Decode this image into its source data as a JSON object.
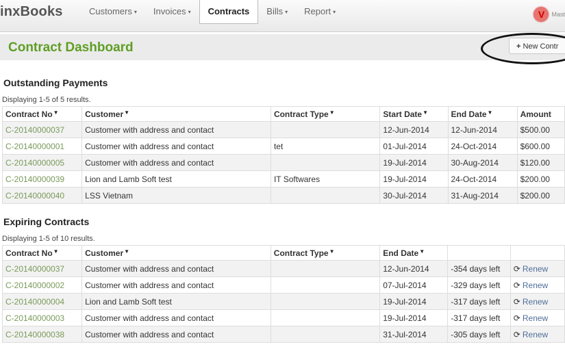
{
  "nav": {
    "brand": "inxBooks",
    "items": [
      {
        "label": "Customers",
        "caret": "▾"
      },
      {
        "label": "Invoices",
        "caret": "▾"
      },
      {
        "label": "Contracts",
        "caret": ""
      },
      {
        "label": "Bills",
        "caret": "▾"
      },
      {
        "label": "Report",
        "caret": "▾"
      }
    ],
    "user_initial": "V",
    "user_name": "Mast"
  },
  "header": {
    "title": "Contract Dashboard",
    "new_button": "New Contr",
    "new_button_icon": "+"
  },
  "outstanding": {
    "title": "Outstanding Payments",
    "summary": "Displaying 1-5 of 5 results.",
    "columns": [
      "Contract No",
      "Customer",
      "Contract Type",
      "Start Date",
      "End Date",
      "Amount"
    ],
    "rows": [
      [
        "C-20140000037",
        "Customer with address and contact",
        "",
        "12-Jun-2014",
        "12-Jun-2014",
        "$500.00"
      ],
      [
        "C-20140000001",
        "Customer with address and contact",
        "tet",
        "01-Jul-2014",
        "24-Oct-2014",
        "$600.00"
      ],
      [
        "C-20140000005",
        "Customer with address and contact",
        "",
        "19-Jul-2014",
        "30-Aug-2014",
        "$120.00"
      ],
      [
        "C-20140000039",
        "Lion and Lamb Soft test",
        "IT Softwares",
        "19-Jul-2014",
        "24-Oct-2014",
        "$200.00"
      ],
      [
        "C-20140000040",
        "LSS Vietnam",
        "",
        "30-Jul-2014",
        "31-Aug-2014",
        "$200.00"
      ]
    ]
  },
  "expiring": {
    "title": "Expiring Contracts",
    "summary": "Displaying 1-5 of 10 results.",
    "columns": [
      "Contract No",
      "Customer",
      "Contract Type",
      "End Date",
      "",
      ""
    ],
    "renew_label": "Renew",
    "rows": [
      [
        "C-20140000037",
        "Customer with address and contact",
        "",
        "12-Jun-2014",
        "-354 days left"
      ],
      [
        "C-20140000002",
        "Customer with address and contact",
        "",
        "07-Jul-2014",
        "-329 days left"
      ],
      [
        "C-20140000004",
        "Lion and Lamb Soft test",
        "",
        "19-Jul-2014",
        "-317 days left"
      ],
      [
        "C-20140000003",
        "Customer with address and contact",
        "",
        "19-Jul-2014",
        "-317 days left"
      ],
      [
        "C-20140000038",
        "Customer with address and contact",
        "",
        "31-Jul-2014",
        "-305 days left"
      ]
    ]
  }
}
